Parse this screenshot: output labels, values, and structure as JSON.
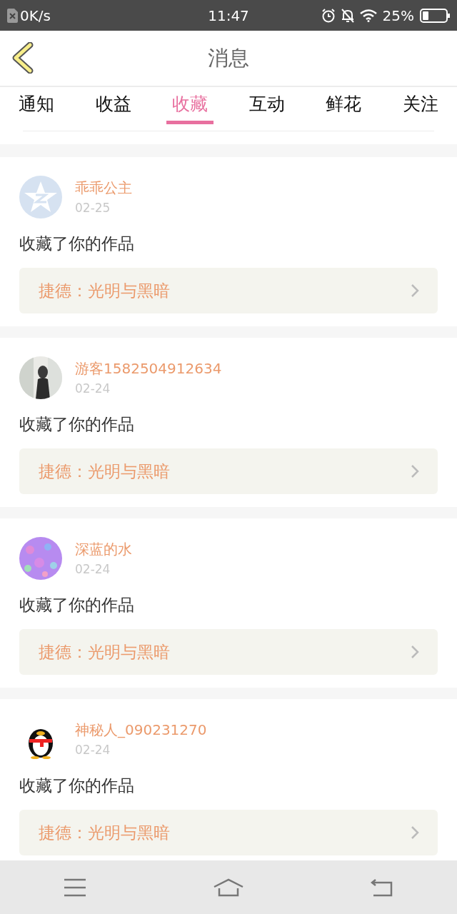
{
  "status_bar": {
    "speed": "0K/s",
    "time": "11:47",
    "battery": "25%"
  },
  "header": {
    "title": "消息"
  },
  "tabs": [
    {
      "label": "通知",
      "selected": false
    },
    {
      "label": "收益",
      "selected": false
    },
    {
      "label": "收藏",
      "selected": true
    },
    {
      "label": "互动",
      "selected": false
    },
    {
      "label": "鲜花",
      "selected": false
    },
    {
      "label": "关注",
      "selected": false
    }
  ],
  "messages": [
    {
      "kind": "star",
      "name": "乖乖公主",
      "date": "02-25",
      "text": "收藏了你的作品",
      "work": "捷德：光明与黑暗"
    },
    {
      "name": "游客1582504912634",
      "date": "02-24",
      "text": "收藏了你的作品",
      "work": "捷德：光明与黑暗"
    },
    {
      "kind": "pattern",
      "name": "深蓝的水",
      "date": "02-24",
      "text": "收藏了你的作品",
      "work": "捷德：光明与黑暗"
    },
    {
      "kind": "figure",
      "name": "神秘人_090231270",
      "date": "02-24",
      "text": "收藏了你的作品",
      "work": "捷德：光明与黑暗"
    }
  ]
}
